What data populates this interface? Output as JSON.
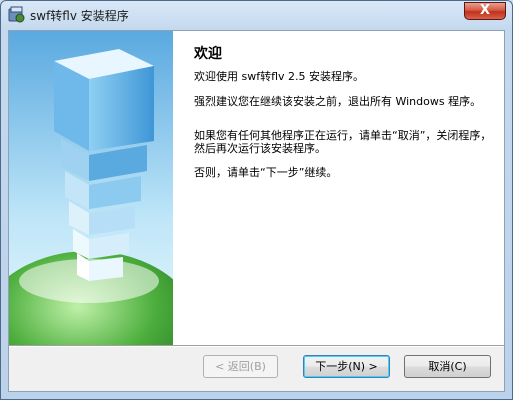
{
  "window": {
    "title": "swf转flv 安装程序",
    "close_label": "X"
  },
  "content": {
    "heading": "欢迎",
    "paragraphs": [
      "欢迎使用 swf转flv 2.5 安装程序。",
      "强烈建议您在继续该安装之前，退出所有 Windows 程序。",
      "如果您有任何其他程序正在运行，请单击“取消”，关闭程序，然后再次运行该安装程序。",
      "否则，请单击“下一步”继续。"
    ]
  },
  "buttons": {
    "back": "< 返回(B)",
    "next": "下一步(N) >",
    "cancel": "取消(C)"
  },
  "colors": {
    "close_button": "#c9412d",
    "default_button_glow": "#48d0f8"
  }
}
